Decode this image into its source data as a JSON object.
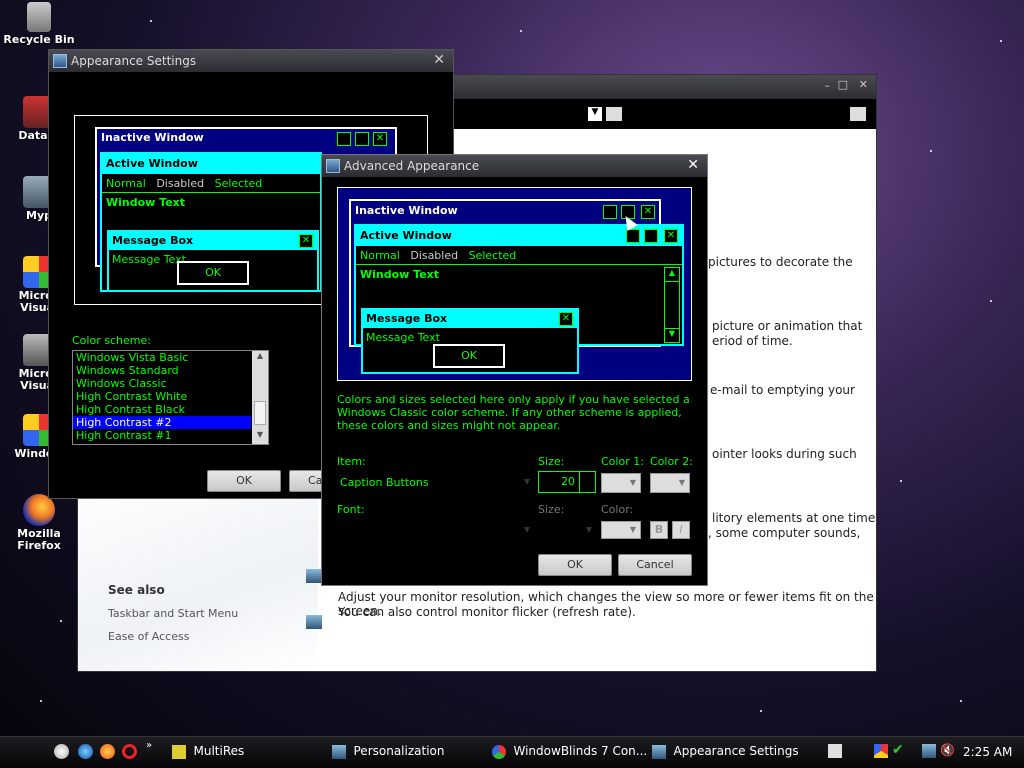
{
  "desktop": {
    "icons": [
      {
        "label": "Recycle Bin",
        "icon": "recycle-bin-icon"
      },
      {
        "label": "DataW",
        "icon": "shortcut-icon"
      },
      {
        "label": "Myp",
        "icon": "shortcut-icon"
      },
      {
        "label": "Micros Visual",
        "icon": "shortcut-icon"
      },
      {
        "label": "Micros Visual",
        "icon": "shortcut-icon"
      },
      {
        "label": "Window",
        "icon": "shortcut-icon"
      },
      {
        "label": "Mozilla Firefox",
        "icon": "firefox-icon"
      }
    ]
  },
  "personalization": {
    "paras": [
      "pictures to decorate the",
      "picture or animation that",
      "eriod of time.",
      "e-mail to emptying your",
      "ointer looks during such",
      "litory elements at one time",
      ", some computer sounds,",
      "Adjust your monitor resolution, which changes the view so more or fewer items fit on the screen.",
      "You can also control monitor flicker (refresh rate)."
    ],
    "see_also": "See also",
    "links": [
      "Taskbar and Start Menu",
      "Ease of Access"
    ]
  },
  "appearance": {
    "title": "Appearance Settings",
    "preview": {
      "inactive": "Inactive Window",
      "active": "Active Window",
      "normal": "Normal",
      "disabled": "Disabled",
      "selected": "Selected",
      "window_text": "Window Text",
      "message_box": "Message Box",
      "message_text": "Message Text",
      "ok": "OK"
    },
    "scheme_label": "Color scheme:",
    "schemes": [
      "Windows Vista Basic",
      "Windows Standard",
      "Windows Classic",
      "High Contrast White",
      "High Contrast Black",
      "High Contrast #2",
      "High Contrast #1"
    ],
    "selected_scheme": "High Contrast #2",
    "ok": "OK",
    "cancel": "Ca"
  },
  "advanced": {
    "title": "Advanced Appearance",
    "preview": {
      "inactive": "Inactive Window",
      "active": "Active Window",
      "normal": "Normal",
      "disabled": "Disabled",
      "selected": "Selected",
      "window_text": "Window Text",
      "message_box": "Message Box",
      "message_text": "Message Text",
      "ok": "OK"
    },
    "note": "Colors and sizes selected here only apply if you have selected a Windows Classic color scheme. If any other scheme is applied, these colors and sizes might not appear.",
    "item_label": "Item:",
    "item_value": "Caption Buttons",
    "size_label": "Size:",
    "size_value": "20",
    "color1_label": "Color 1:",
    "color2_label": "Color 2:",
    "font_label": "Font:",
    "font_size_label": "Size:",
    "font_color_label": "Color:",
    "bold": "B",
    "italic": "I",
    "ok": "OK",
    "cancel": "Cancel"
  },
  "taskbar": {
    "items": [
      {
        "label": "MultiRes",
        "icon": "multires-icon"
      },
      {
        "label": "Personalization",
        "icon": "personalization-icon"
      },
      {
        "label": "WindowBlinds 7 Con...",
        "icon": "windowblinds-icon"
      },
      {
        "label": "Appearance Settings",
        "icon": "appearance-icon"
      }
    ],
    "clock": "2:25 AM"
  },
  "colors": {
    "hc_green": "#00ff00",
    "hc_cyan": "#00ffff",
    "hc_blue": "#0000ff",
    "hc_navy": "#000080"
  }
}
